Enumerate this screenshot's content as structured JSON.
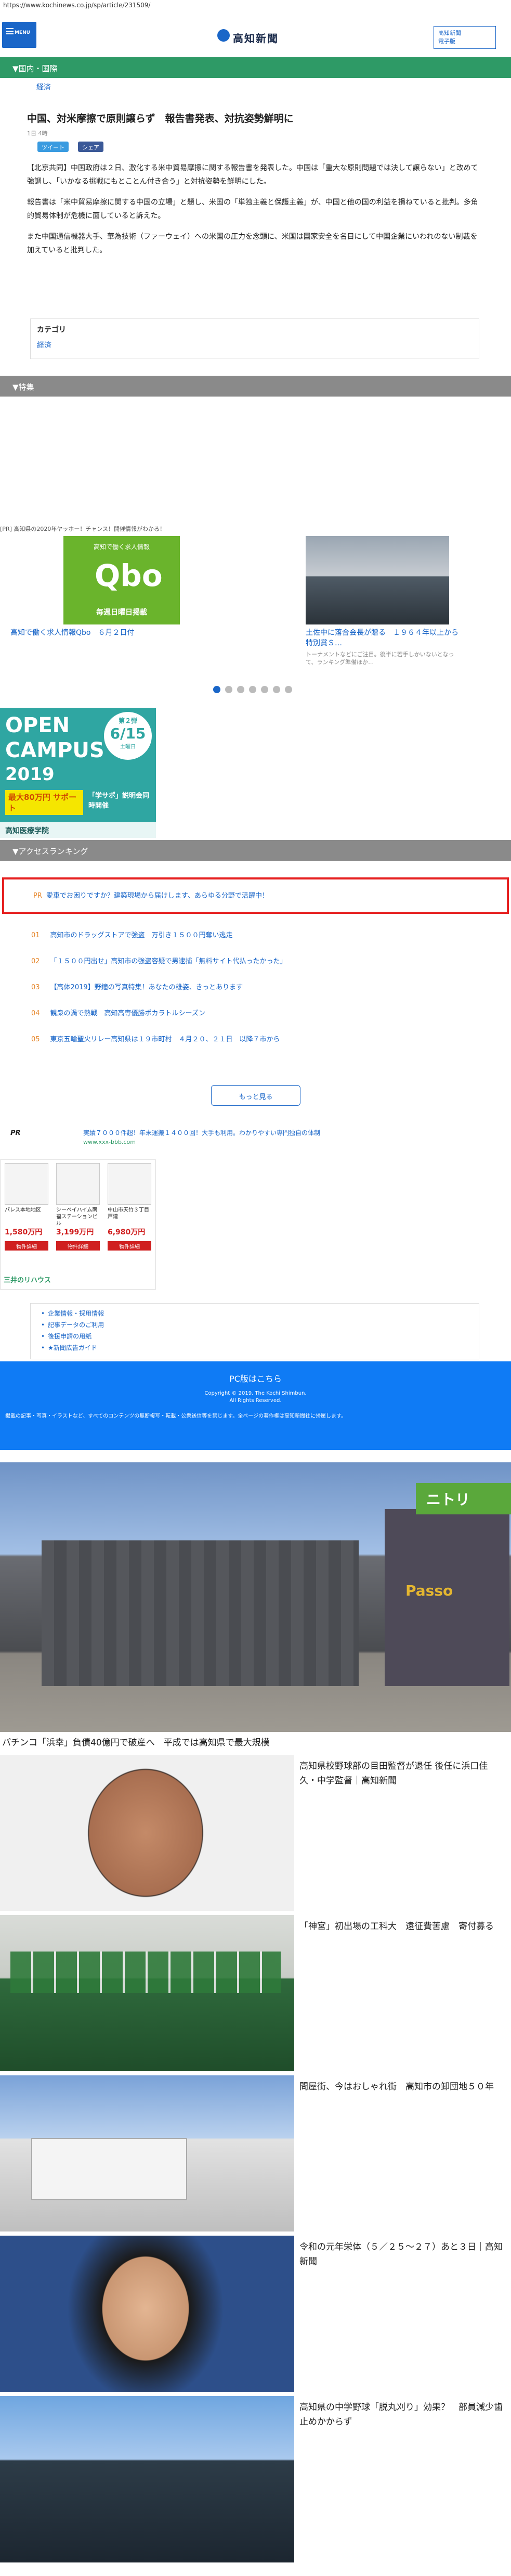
{
  "browser": {
    "url": "https://www.kochinews.co.jp/sp/article/231509/"
  },
  "header": {
    "menu_label": "MENU",
    "logo_text": "高知新聞",
    "subscribe_line1": "高知新聞",
    "subscribe_line2": "電子版"
  },
  "section": {
    "name": "▼国内・国際",
    "category_link": "経済"
  },
  "article": {
    "title": "中国、対米摩擦で原則譲らず　報告書発表、対抗姿勢鮮明に",
    "date": "1日 4時",
    "share_twitter": "ツイート",
    "share_facebook": "シェア",
    "paragraphs": [
      "【北京共同】中国政府は２日、激化する米中貿易摩擦に関する報告書を発表した。中国は「重大な原則問題では決して譲らない」と改めて強調し、「いかなる挑戦にもとことん付き合う」と対抗姿勢を鮮明にした。",
      "報告書は「米中貿易摩擦に関する中国の立場」と題し、米国の「単独主義と保護主義」が、中国と他の国の利益を損ねていると批判。多角的貿易体制が危機に面していると訴えた。",
      "また中国通信機器大手、華為技術（ファーウェイ）への米国の圧力を念頭に、米国は国家安全を名目にして中国企業にいわれのない制裁を加えていると批判した。"
    ]
  },
  "category_box": {
    "heading": "カテゴリ",
    "link": "経済"
  },
  "feature": {
    "heading": "▼特集",
    "cards": [
      {
        "top_caption": "[PR] 高知県の2020年ヤッホー！チャンス！開催情報がわかる！",
        "image_line1": "高知で働く求人情報",
        "image_logo": "Qbo",
        "image_line2": "毎週日曜日掲載",
        "title": "高知で働く求人情報Qbo　６月２日付",
        "desc": ""
      },
      {
        "top_caption": "",
        "title": "土佐中に落合会長が贈る　１９６４年以上から特別賞Ｓ…",
        "desc": "トーナメントなどにご注目。後半に若手しかいないとなって、ランキング準備ほか…"
      }
    ],
    "dots_count": 7
  },
  "banner_ad": {
    "line1": "OPEN",
    "line2": "CAMPUS",
    "year": "2019",
    "date_label": "第２弾",
    "date_main": "6/15",
    "date_day": "土曜日",
    "yellow_text": "最大80万円 サポート",
    "right_text": "「学サポ」説明会同時開催",
    "bottom": "高知医療学院"
  },
  "ranking": {
    "heading": "▼アクセスランキング",
    "pr_label": "PR",
    "pr_text": "愛車でお困りですか？建築現場から届けします、あらゆる分野で活躍中！",
    "items": [
      {
        "num": "01",
        "text": "高知市のドラッグストアで強盗　万引き１５００円奪い逃走"
      },
      {
        "num": "02",
        "text": "「１５００円出せ」高知市の強盗容疑で男逮捕「無料サイト代払ったかった」"
      },
      {
        "num": "03",
        "text": "【高体2019】野鐘の写真特集！あなたの雄姿、きっとあります"
      },
      {
        "num": "04",
        "text": "観衆の渦で熱戦　高知高専優勝ポカラトルシーズン"
      },
      {
        "num": "05",
        "text": "東京五輪聖火リレー高知県は１９市町村　４月２０、２１日　以降７市から"
      }
    ],
    "more_label": "もっと見る"
  },
  "pr_ad": {
    "pr_label": "PR",
    "title": "実績７０００件超！年末運搬１４００回！大手も利用。わかりやすい専門独自の体制",
    "url": "www.xxx-bbb.com"
  },
  "suumo": {
    "cells": [
      {
        "name": "パレス本地地区",
        "price": "1,580万円",
        "button": "物件詳細"
      },
      {
        "name": "シーベイハイム南 福ステーションビ ル",
        "price": "3,199万円",
        "button": "物件詳細"
      },
      {
        "name": "中山市天竹３丁目 戸建",
        "price": "6,980万円",
        "button": "物件詳細"
      }
    ],
    "brand": "三井のリハウス"
  },
  "footer_links": [
    "企業情報・採用情報",
    "記事データのご利用",
    "後援申請の用紙",
    "★新聞広告ガイド"
  ],
  "pc_bar": {
    "pc_link": "PC版はこちら",
    "copyright1": "Copyright © 2019, The Kochi Shimbun.",
    "copyright2": "All Rights Reserved."
  },
  "pc_notice": "掲載の記事・写真・イラストなど、すべてのコンテンツの無断複写・転載・公衆送信等を禁じます。全ページの著作権は高知新聞社に帰属します。",
  "stories": {
    "pachinko_caption": "パチンコ「浜幸」負債40億円で破産へ　平成では高知県で最大規模",
    "pachinko_sign": "Passo",
    "pachinko_store": "ニトリ",
    "items": [
      {
        "title": "高知県校野球部の目田監督が退任 後任に浜口佳久・中学監督｜高知新聞"
      },
      {
        "title": "「神宮」初出場の工科大　遠征費苦慮　寄付募る"
      },
      {
        "title": "問屋街、今はおしゃれ街　高知市の卸団地５０年"
      },
      {
        "title": "令和の元年栄体（５／２５～２７）あと３日｜高知新聞"
      },
      {
        "title": "高知県の中学野球「脱丸刈り」効果？　部員減少歯止めかからず"
      }
    ]
  }
}
